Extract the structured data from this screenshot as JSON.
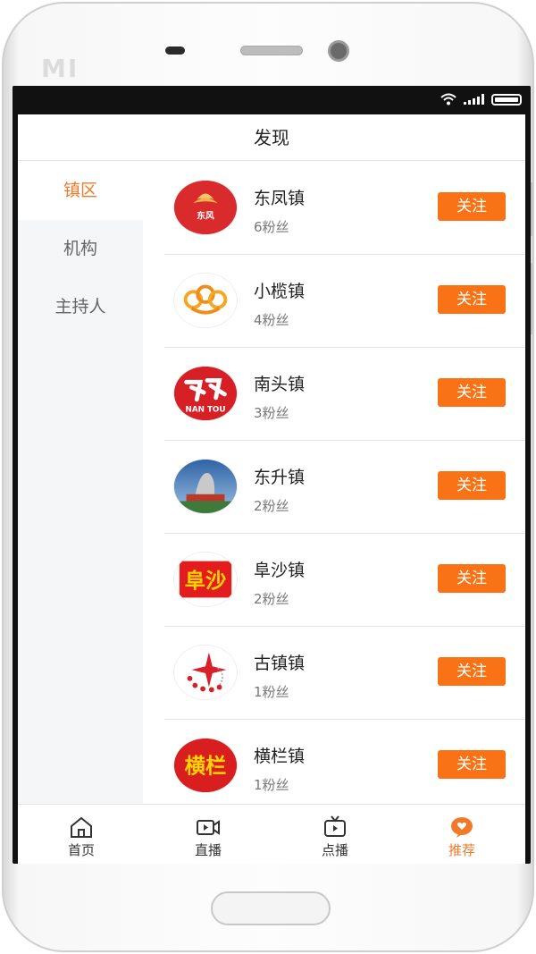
{
  "device": {
    "brand": "MI"
  },
  "header": {
    "title": "发现"
  },
  "sidebar": {
    "items": [
      {
        "label": "镇区",
        "active": true
      },
      {
        "label": "机构",
        "active": false
      },
      {
        "label": "主持人",
        "active": false
      }
    ]
  },
  "towns": [
    {
      "name": "东凤镇",
      "fans": "6粉丝",
      "follow": "关注",
      "logo_text": "东风",
      "logo_icon": "dongfeng-logo-icon",
      "logo_color": "#d92b2b"
    },
    {
      "name": "小榄镇",
      "fans": "4粉丝",
      "follow": "关注",
      "logo_text": "",
      "logo_icon": "chrysanthemum-logo-icon",
      "logo_color": "#f5a623"
    },
    {
      "name": "南头镇",
      "fans": "3粉丝",
      "follow": "关注",
      "logo_text": "NAN TOU",
      "logo_icon": "nantou-logo-icon",
      "logo_color": "#d71f26"
    },
    {
      "name": "东升镇",
      "fans": "2粉丝",
      "follow": "关注",
      "logo_text": "",
      "logo_icon": "monument-photo-icon",
      "logo_color": "#4b79b0"
    },
    {
      "name": "阜沙镇",
      "fans": "2粉丝",
      "follow": "关注",
      "logo_text": "阜沙",
      "logo_icon": "fusha-logo-icon",
      "logo_color": "#e31d1d"
    },
    {
      "name": "古镇镇",
      "fans": "1粉丝",
      "follow": "关注",
      "logo_text": "",
      "logo_icon": "star-logo-icon",
      "logo_color": "#d7202a"
    },
    {
      "name": "横栏镇",
      "fans": "1粉丝",
      "follow": "关注",
      "logo_text": "横栏",
      "logo_icon": "henglan-logo-icon",
      "logo_color": "#d81e1e"
    }
  ],
  "tabbar": {
    "items": [
      {
        "label": "首页",
        "icon": "home-icon",
        "active": false
      },
      {
        "label": "直播",
        "icon": "live-camera-icon",
        "active": false
      },
      {
        "label": "点播",
        "icon": "tv-play-icon",
        "active": false
      },
      {
        "label": "推荐",
        "icon": "heart-bubble-icon",
        "active": true
      }
    ]
  },
  "colors": {
    "accent": "#f97316",
    "active_text": "#f07a2a"
  }
}
